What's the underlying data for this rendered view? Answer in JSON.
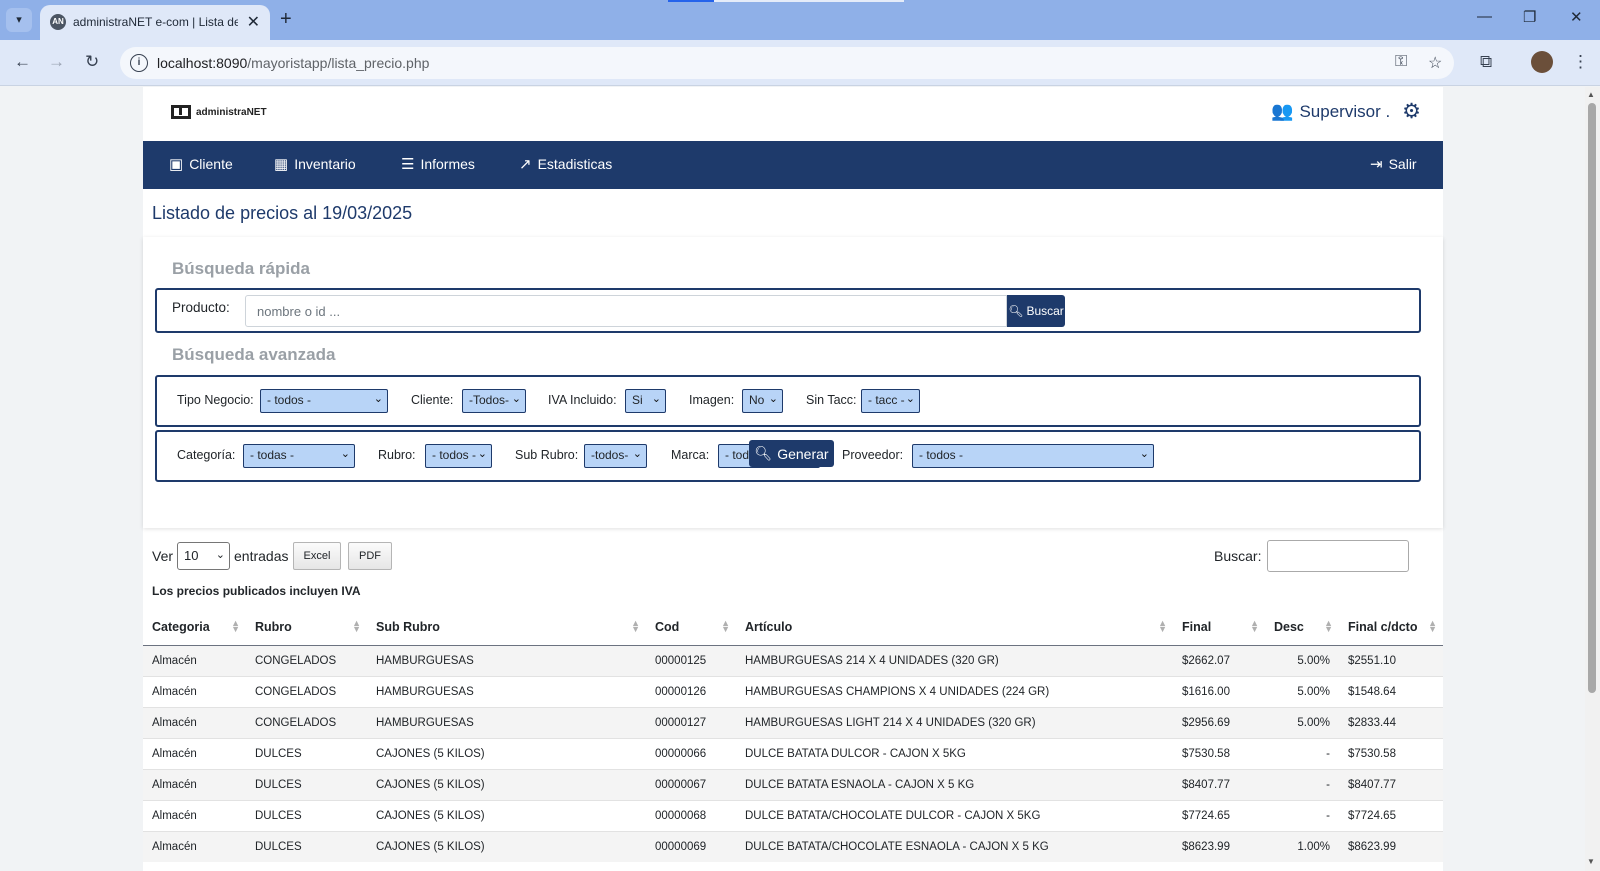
{
  "browser": {
    "tab_title": "administraNET e-com | Lista de",
    "tab_favicon": "AN",
    "url_host": "localhost:8090",
    "url_path": "/mayoristapp/lista_precio.php"
  },
  "brand": {
    "name": "administraNET"
  },
  "user": {
    "label": "Supervisor ."
  },
  "nav": [
    {
      "label": "Cliente",
      "icon": "address-card-icon",
      "glyph": "▣"
    },
    {
      "label": "Inventario",
      "icon": "boxes-icon",
      "glyph": "▦"
    },
    {
      "label": "Informes",
      "icon": "list-alt-icon",
      "glyph": "☰"
    },
    {
      "label": "Estadisticas",
      "icon": "chart-line-icon",
      "glyph": "📈"
    }
  ],
  "logout_label": "Salir",
  "page_title": "Listado de precios al 19/03/2025",
  "quick_search": {
    "title": "Búsqueda rápida",
    "product_label": "Producto:",
    "placeholder": "nombre o id ...",
    "button": "Buscar"
  },
  "advanced_search": {
    "title": "Búsqueda avanzada",
    "row1": [
      {
        "label": "Tipo Negocio:",
        "value": "- todos -"
      },
      {
        "label": "Cliente:",
        "value": "-Todos-"
      },
      {
        "label": "IVA Incluido:",
        "value": "Si"
      },
      {
        "label": "Imagen:",
        "value": "No"
      },
      {
        "label": "Sin Tacc:",
        "value": "- tacc -"
      }
    ],
    "row2": [
      {
        "label": "Categoría:",
        "value": "- todas -"
      },
      {
        "label": "Rubro:",
        "value": "- todos -"
      },
      {
        "label": "Sub Rubro:",
        "value": "-todos-"
      },
      {
        "label": "Marca:",
        "value": "- todos -"
      },
      {
        "label": "Proveedor:",
        "value": "- todos -"
      }
    ],
    "generate_button": "Generar"
  },
  "datatable": {
    "show_label": "Ver",
    "page_length": "10",
    "entries_label": "entradas",
    "excel_button": "Excel",
    "pdf_button": "PDF",
    "search_label": "Buscar:",
    "iva_note": "Los precios publicados incluyen IVA",
    "columns": [
      "Categoria",
      "Rubro",
      "Sub Rubro",
      "Cod",
      "Artículo",
      "Final",
      "Desc",
      "Final c/dcto"
    ],
    "rows": [
      [
        "Almacén",
        "CONGELADOS",
        "HAMBURGUESAS",
        "00000125",
        "HAMBURGUESAS 214 X 4 UNIDADES (320 GR)",
        "$2662.07",
        "5.00%",
        "$2551.10"
      ],
      [
        "Almacén",
        "CONGELADOS",
        "HAMBURGUESAS",
        "00000126",
        "HAMBURGUESAS CHAMPIONS X 4 UNIDADES (224 GR)",
        "$1616.00",
        "5.00%",
        "$1548.64"
      ],
      [
        "Almacén",
        "CONGELADOS",
        "HAMBURGUESAS",
        "00000127",
        "HAMBURGUESAS LIGHT 214 X 4 UNIDADES (320 GR)",
        "$2956.69",
        "5.00%",
        "$2833.44"
      ],
      [
        "Almacén",
        "DULCES",
        "CAJONES (5 KILOS)",
        "00000066",
        "DULCE BATATA DULCOR - CAJON X 5KG",
        "$7530.58",
        "-",
        "$7530.58"
      ],
      [
        "Almacén",
        "DULCES",
        "CAJONES (5 KILOS)",
        "00000067",
        "DULCE BATATA ESNAOLA - CAJON X 5 KG",
        "$8407.77",
        "-",
        "$8407.77"
      ],
      [
        "Almacén",
        "DULCES",
        "CAJONES (5 KILOS)",
        "00000068",
        "DULCE BATATA/CHOCOLATE DULCOR - CAJON X 5KG",
        "$7724.65",
        "-",
        "$7724.65"
      ],
      [
        "Almacén",
        "DULCES",
        "CAJONES (5 KILOS)",
        "00000069",
        "DULCE BATATA/CHOCOLATE ESNAOLA - CAJON X 5 KG",
        "$8623.99",
        "1.00%",
        "$8623.99"
      ]
    ]
  },
  "colors": {
    "primary": "#1e3a6b",
    "select_bg": "#b8d4f7",
    "browser_frame": "#8fb0e8"
  }
}
